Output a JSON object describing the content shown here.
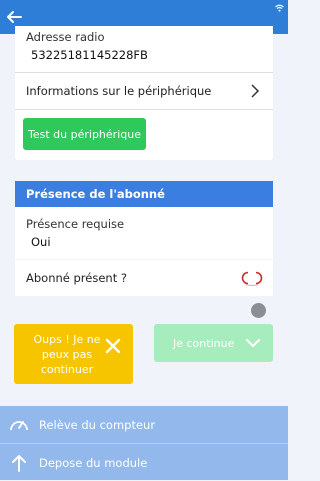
{
  "device": {
    "radio_address_label": "Adresse radio",
    "radio_address_value": "53225181145228FB",
    "info_label": "Informations sur le périphérique",
    "test_button_label": "Test du périphérique"
  },
  "presence": {
    "section_title": "Présence de l'abonné",
    "required_label": "Présence requise",
    "required_value": "Oui",
    "present_question": "Abonné présent ?",
    "present_toggle": "off"
  },
  "actions": {
    "oops_label": "Oups ! Je ne peux pas continuer",
    "continue_label": "Je continue"
  },
  "bottom_nav": {
    "items": [
      {
        "label": "Relève du compteur",
        "icon": "gauge-icon"
      },
      {
        "label": "Depose du module",
        "icon": "arrow-up-icon"
      }
    ]
  },
  "colors": {
    "topbar": "#2e7ed8",
    "section_header": "#3a7fe0",
    "test_button": "#2ec95a",
    "oops_button": "#f7c400",
    "continue_button": "#a6ecbc",
    "bottom_nav": "#93b8ec"
  }
}
